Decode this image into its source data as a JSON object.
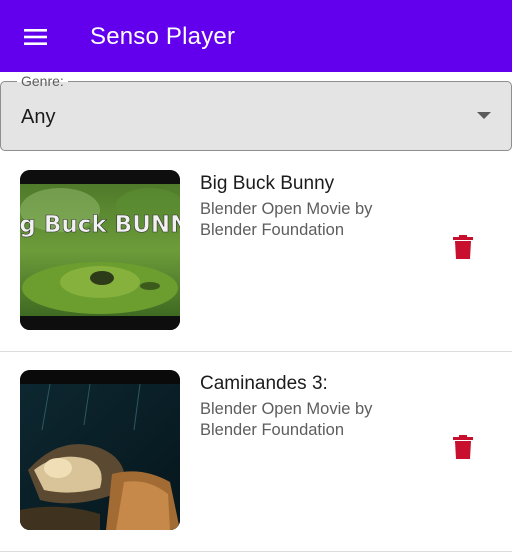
{
  "app_bar": {
    "title": "Senso Player",
    "background": "#6200ee",
    "menu_icon": "menu-icon"
  },
  "genre_filter": {
    "label": "Genre:",
    "selected": "Any",
    "caret_icon": "dropdown-arrow-icon"
  },
  "videos": [
    {
      "title": "Big Buck Bunny",
      "subtitle": "Blender Open Movie by Blender Foundation",
      "thumbnail_text": "Big Buck BUNNY",
      "delete_icon": "delete-icon"
    },
    {
      "title": "Caminandes 3:",
      "subtitle": "Blender Open Movie by Blender Foundation",
      "delete_icon": "delete-icon"
    }
  ],
  "colors": {
    "primary": "#6200ee",
    "delete": "#c8102e",
    "divider": "#dcdcdc"
  }
}
